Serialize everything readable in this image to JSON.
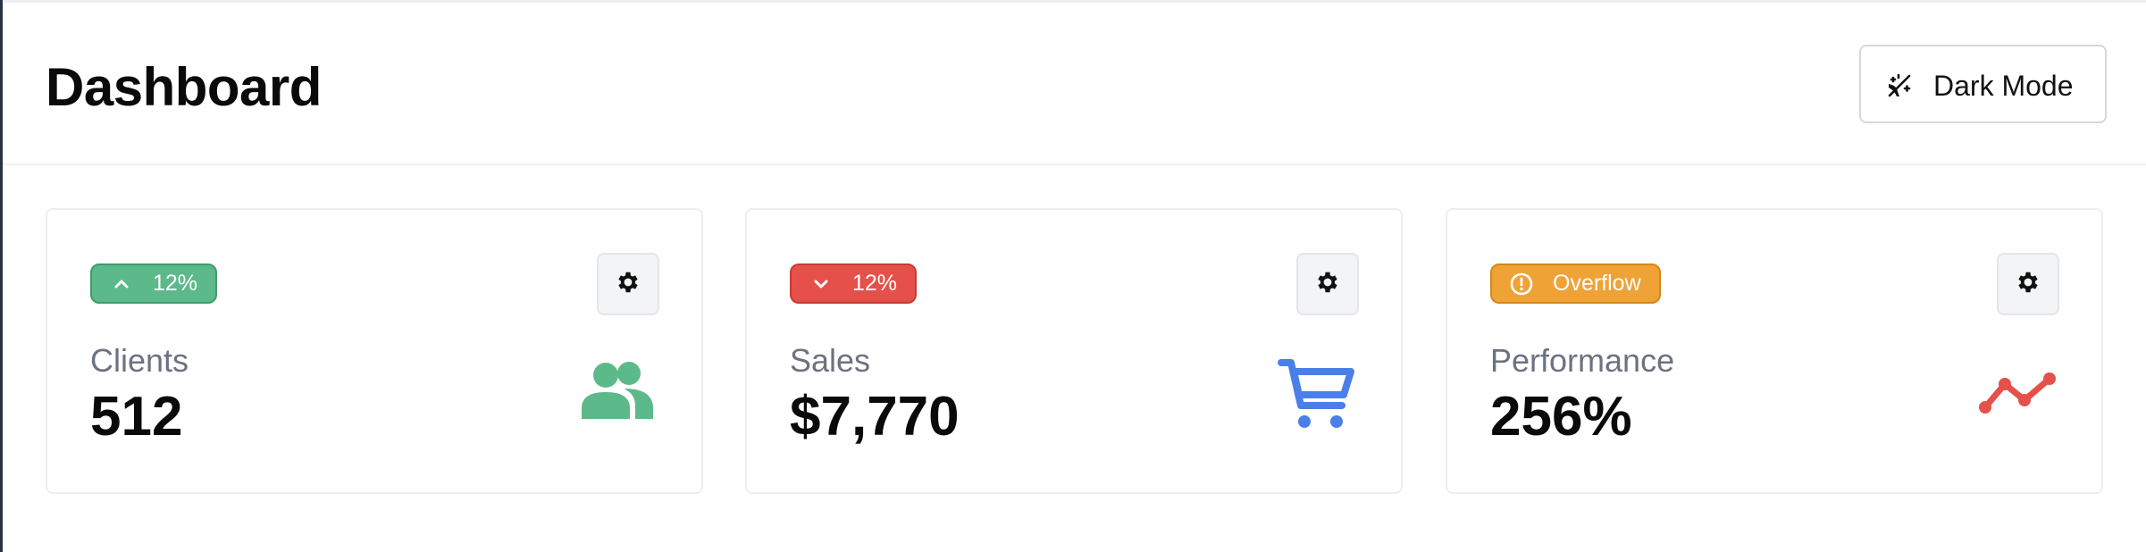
{
  "header": {
    "title": "Dashboard",
    "dark_mode_label": "Dark Mode"
  },
  "colors": {
    "green": "#5cb98a",
    "red": "#e5514a",
    "amber": "#efa236",
    "blue": "#4a7fea"
  },
  "cards": [
    {
      "badge": {
        "text": "12%",
        "icon": "chevron-up-icon",
        "color": "green"
      },
      "label": "Clients",
      "value": "512",
      "icon": "users-icon"
    },
    {
      "badge": {
        "text": "12%",
        "icon": "chevron-down-icon",
        "color": "red"
      },
      "label": "Sales",
      "value": "$7,770",
      "icon": "shopping-cart-icon"
    },
    {
      "badge": {
        "text": "Overflow",
        "icon": "alert-circle-icon",
        "color": "amber"
      },
      "label": "Performance",
      "value": "256%",
      "icon": "trending-chart-icon"
    }
  ]
}
